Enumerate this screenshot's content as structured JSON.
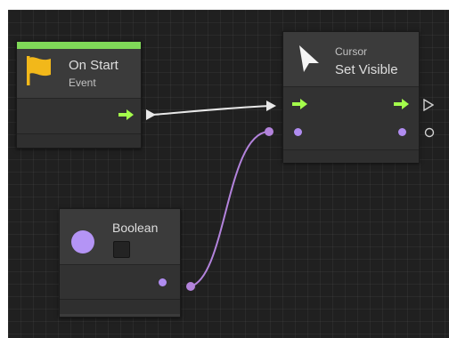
{
  "nodes": {
    "on_start": {
      "title": "On Start",
      "subtitle": "Event",
      "header_color": "#7fd858"
    },
    "set_visible": {
      "category": "Cursor",
      "title": "Set Visible"
    },
    "boolean": {
      "title": "Boolean",
      "checked": false
    }
  },
  "colors": {
    "canvas": "#202020",
    "node": "#3b3b3b",
    "flow_port": "#a4ff4b",
    "value_port": "#b08cf0",
    "flow_wire": "#e8e8e8",
    "value_wire": "#b383dc",
    "icon_flag": "#f2b81a"
  },
  "icons": {
    "event": "flag-icon",
    "cursor": "cursor-arrow-icon",
    "boolean": "purple-circle-icon"
  }
}
